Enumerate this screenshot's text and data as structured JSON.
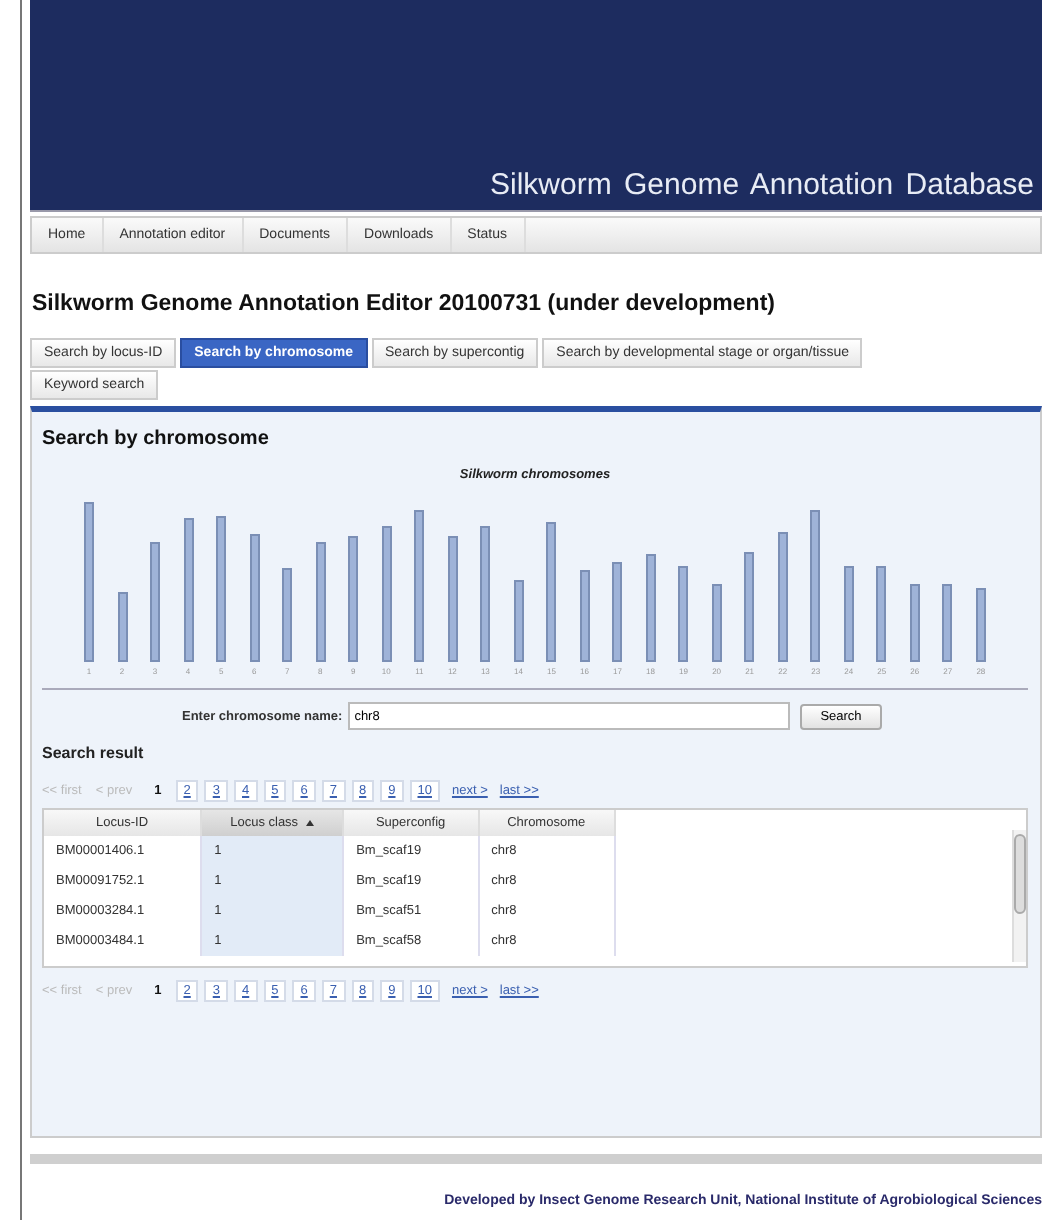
{
  "banner": {
    "title": "Silkworm Genome Annotation Database"
  },
  "nav": [
    "Home",
    "Annotation editor",
    "Documents",
    "Downloads",
    "Status"
  ],
  "heading": "Silkworm Genome Annotation Editor 20100731 (under development)",
  "tabs": [
    {
      "label": "Search by locus-ID",
      "selected": false
    },
    {
      "label": "Search by chromosome",
      "selected": true
    },
    {
      "label": "Search by supercontig",
      "selected": false
    },
    {
      "label": "Search by developmental stage or organ/tissue",
      "selected": false
    },
    {
      "label": "Keyword search",
      "selected": false
    }
  ],
  "panel": {
    "title": "Search by chromosome",
    "chromosome_chart": {
      "title": "Silkworm chromosomes",
      "labels": [
        "1",
        "2",
        "3",
        "4",
        "5",
        "6",
        "7",
        "8",
        "9",
        "10",
        "11",
        "12",
        "13",
        "14",
        "15",
        "16",
        "17",
        "18",
        "19",
        "20",
        "21",
        "22",
        "23",
        "24",
        "25",
        "26",
        "27",
        "28"
      ]
    },
    "search": {
      "label": "Enter chromosome name:",
      "value": "chr8",
      "button": "Search"
    },
    "result_title": "Search result",
    "pager_top": {
      "first": "<< first",
      "prev": "< prev",
      "pages": [
        {
          "label": "1",
          "selected": true
        },
        {
          "label": "2",
          "selected": false
        },
        {
          "label": "3",
          "selected": false
        },
        {
          "label": "4",
          "selected": false
        },
        {
          "label": "5",
          "selected": false
        },
        {
          "label": "6",
          "selected": false
        },
        {
          "label": "7",
          "selected": false
        },
        {
          "label": "8",
          "selected": false
        },
        {
          "label": "9",
          "selected": false
        },
        {
          "label": "10",
          "selected": false
        }
      ],
      "next": "next >",
      "last": "last >>"
    },
    "table": {
      "columns": [
        {
          "label": "Locus-ID",
          "sorted": false
        },
        {
          "label": "Locus class",
          "sorted": true
        },
        {
          "label": "Superconfig",
          "sorted": false
        },
        {
          "label": "Chromosome",
          "sorted": false
        }
      ],
      "rows": [
        [
          "BM00001406.1",
          "1",
          "Bm_scaf19",
          "chr8"
        ],
        [
          "BM00091752.1",
          "1",
          "Bm_scaf19",
          "chr8"
        ],
        [
          "BM00003284.1",
          "1",
          "Bm_scaf51",
          "chr8"
        ],
        [
          "BM00003484.1",
          "1",
          "Bm_scaf58",
          "chr8"
        ]
      ]
    },
    "pager_bottom": {
      "first": "<< first",
      "prev": "< prev",
      "pages": [
        {
          "label": "1",
          "selected": true
        },
        {
          "label": "2",
          "selected": false
        },
        {
          "label": "3",
          "selected": false
        },
        {
          "label": "4",
          "selected": false
        },
        {
          "label": "5",
          "selected": false
        },
        {
          "label": "6",
          "selected": false
        },
        {
          "label": "7",
          "selected": false
        },
        {
          "label": "8",
          "selected": false
        },
        {
          "label": "9",
          "selected": false
        },
        {
          "label": "10",
          "selected": false
        }
      ],
      "next": "next >",
      "last": "last >>"
    }
  },
  "footer": "Developed by Insect Genome Research Unit, National Institute of Agrobiological Sciences"
}
